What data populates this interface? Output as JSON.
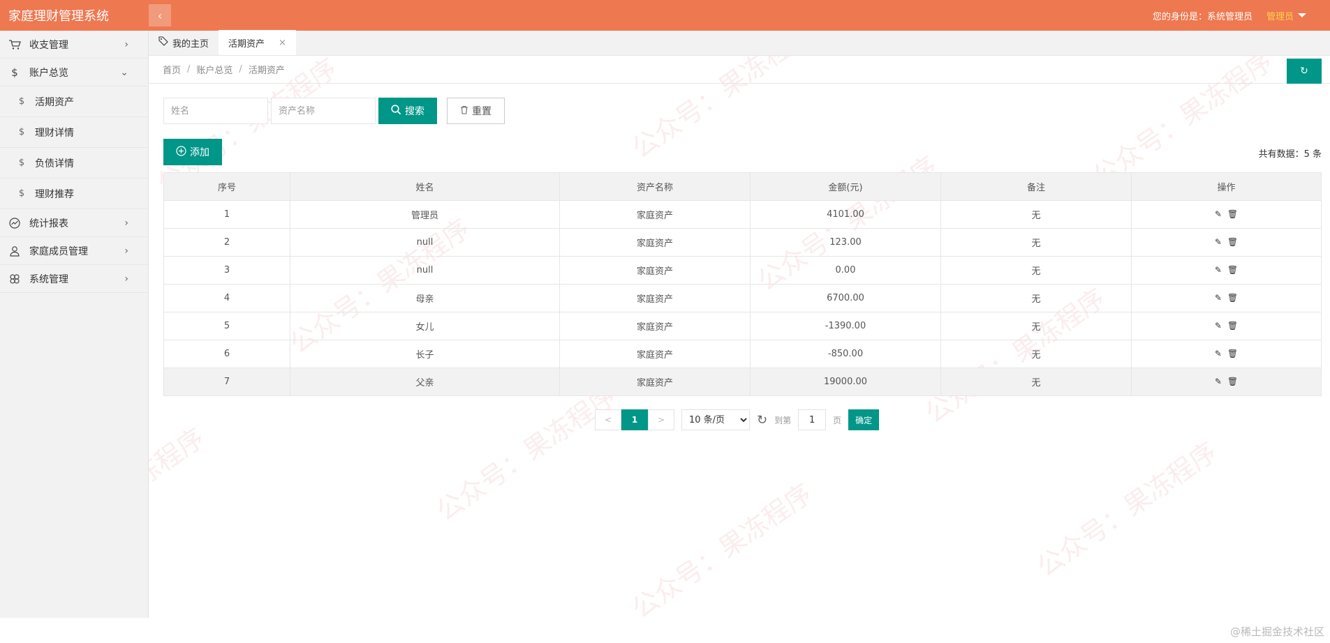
{
  "header": {
    "title": "家庭理财管理系统",
    "identity_label": "您的身份是：系统管理员",
    "admin_name": "管理员"
  },
  "sidebar": {
    "items": [
      {
        "label": "收支管理",
        "icon": "cart-icon"
      },
      {
        "label": "账户总览",
        "icon": "dollar-icon"
      },
      {
        "label": "统计报表",
        "icon": "chart-icon"
      },
      {
        "label": "家庭成员管理",
        "icon": "user-icon"
      },
      {
        "label": "系统管理",
        "icon": "flower-icon"
      }
    ],
    "subitems": [
      {
        "label": "活期资产"
      },
      {
        "label": "理财详情"
      },
      {
        "label": "负债详情"
      },
      {
        "label": "理财推荐"
      }
    ]
  },
  "tabs": [
    {
      "label": "我的主页"
    },
    {
      "label": "活期资产"
    }
  ],
  "breadcrumb": [
    "首页",
    "账户总览",
    "活期资产"
  ],
  "search": {
    "name_placeholder": "姓名",
    "asset_placeholder": "资产名称",
    "search_label": "搜索",
    "reset_label": "重置"
  },
  "add_label": "添加",
  "total_text": "共有数据：5 条",
  "table": {
    "headers": [
      "序号",
      "姓名",
      "资产名称",
      "金额(元)",
      "备注",
      "操作"
    ],
    "rows": [
      [
        "1",
        "管理员",
        "家庭资产",
        "4101.00",
        "无"
      ],
      [
        "2",
        "null",
        "家庭资产",
        "123.00",
        "无"
      ],
      [
        "3",
        "null",
        "家庭资产",
        "0.00",
        "无"
      ],
      [
        "4",
        "母亲",
        "家庭资产",
        "6700.00",
        "无"
      ],
      [
        "5",
        "女儿",
        "家庭资产",
        "-1390.00",
        "无"
      ],
      [
        "6",
        "长子",
        "家庭资产",
        "-850.00",
        "无"
      ],
      [
        "7",
        "父亲",
        "家庭资产",
        "19000.00",
        "无"
      ]
    ]
  },
  "pagination": {
    "prev": "<",
    "current": "1",
    "next": ">",
    "page_size": "10 条/页",
    "goto_label": "到第",
    "goto_value": "1",
    "page_unit": "页",
    "confirm_label": "确定"
  },
  "watermark": {
    "text": "公众号：果冻程序",
    "footer": "@稀土掘金技术社区"
  },
  "colors": {
    "header_bg": "#ee7850",
    "accent": "#009688",
    "admin_text": "#ffd24d"
  }
}
